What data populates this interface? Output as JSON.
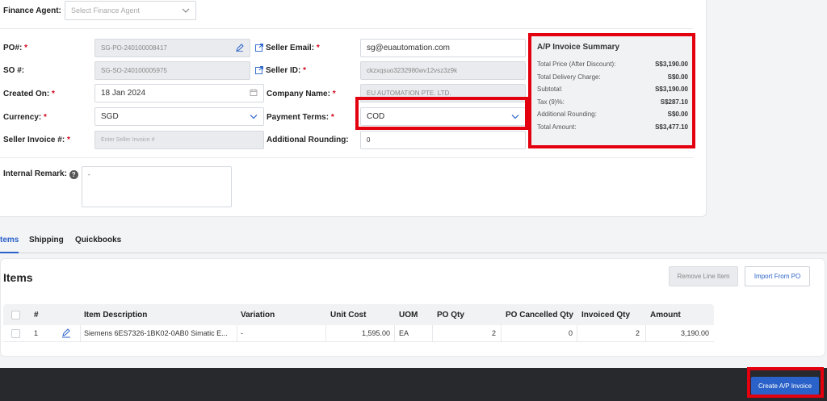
{
  "finance_agent": {
    "label": "Finance Agent:",
    "placeholder": "Select Finance Agent"
  },
  "form": {
    "po": {
      "label": "PO#:",
      "value": "SG-PO-240100008417"
    },
    "so": {
      "label": "SO #:",
      "value": "SG-SO-240100005975"
    },
    "created_on": {
      "label": "Created On:",
      "value": "18 Jan 2024"
    },
    "currency": {
      "label": "Currency:",
      "value": "SGD"
    },
    "seller_invoice": {
      "label": "Seller Invoice #:",
      "placeholder": "Enter Seller Invoice #"
    },
    "seller_email": {
      "label": "Seller Email:",
      "value": "sg@euautomation.com"
    },
    "seller_id": {
      "label": "Seller ID:",
      "value": "ckzxqsuo3232980wv12vsz3z9k"
    },
    "company_name": {
      "label": "Company Name:",
      "value": "EU AUTOMATION PTE. LTD."
    },
    "payment_terms": {
      "label": "Payment Terms:",
      "value": "COD"
    },
    "additional_rounding": {
      "label": "Additional Rounding:",
      "value": "0"
    },
    "internal_remark": {
      "label": "Internal Remark:",
      "value": "-"
    },
    "required_mark": "*"
  },
  "summary": {
    "title": "A/P Invoice Summary",
    "rows": [
      {
        "label": "Total Price (After Discount):",
        "value": "S$3,190.00"
      },
      {
        "label": "Total Delivery Charge:",
        "value": "S$0.00"
      },
      {
        "label": "Subtotal:",
        "value": "S$3,190.00"
      },
      {
        "label": "Tax (9)%:",
        "value": "S$287.10"
      },
      {
        "label": "Additional Rounding:",
        "value": "S$0.00"
      },
      {
        "label": "Total Amount:",
        "value": "S$3,477.10"
      }
    ]
  },
  "tabs": [
    "tems",
    "Shipping",
    "Quickbooks"
  ],
  "items": {
    "title": "Items",
    "remove_button": "Remove Line Item",
    "import_button": "Import From PO",
    "columns": [
      "#",
      "Item Description",
      "Variation",
      "Unit Cost",
      "UOM",
      "PO Qty",
      "PO Cancelled Qty",
      "Invoiced Qty",
      "Amount"
    ],
    "rows": [
      {
        "num": "1",
        "description": "Siemens 6ES7326-1BK02-0AB0 Simatic E...",
        "variation": "-",
        "unit_cost": "1,595.00",
        "uom": "EA",
        "po_qty": "2",
        "po_cancelled_qty": "0",
        "invoiced_qty": "2",
        "amount": "3,190.00"
      }
    ]
  },
  "footer": {
    "create_button": "Create A/P Invoice"
  },
  "colors": {
    "accent": "#2a62c9",
    "highlight": "#e3000f",
    "footer": "#27292d"
  }
}
